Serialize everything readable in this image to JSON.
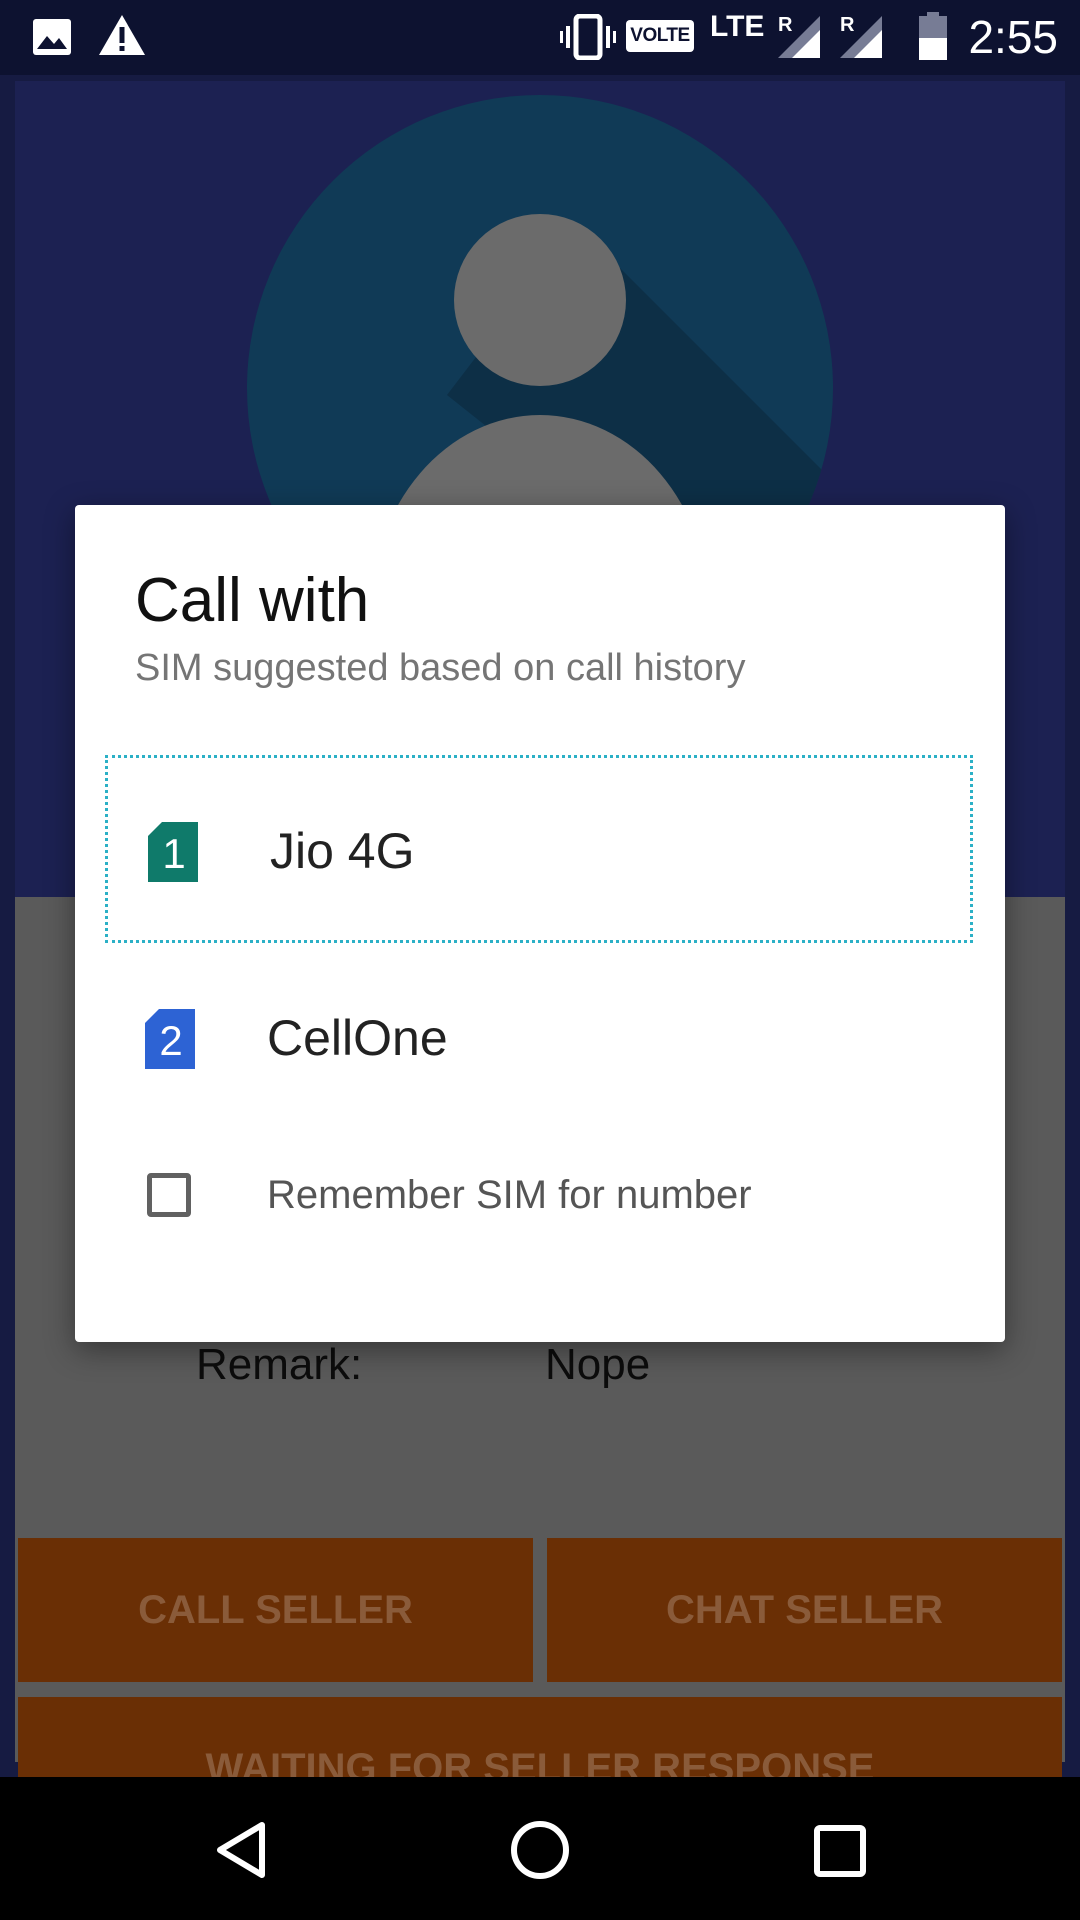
{
  "status_bar": {
    "time": "2:55",
    "volte": "VOLTE",
    "network": "LTE",
    "roaming_1": "R",
    "roaming_2": "R",
    "icons": [
      "image-icon",
      "warning-icon",
      "vibrate-icon",
      "signal-icon",
      "signal-icon",
      "battery-icon"
    ]
  },
  "details": {
    "remark_label": "Remark:",
    "remark_value": "Nope"
  },
  "actions": {
    "call_seller": "CALL SELLER",
    "chat_seller": "CHAT SELLER",
    "waiting": "WAITING FOR SELLER RESPONSE"
  },
  "dialog": {
    "title": "Call with",
    "subtitle": "SIM suggested based on call history",
    "sims": [
      {
        "slot": "1",
        "label": "Jio 4G",
        "color": "#0f7a6a"
      },
      {
        "slot": "2",
        "label": "CellOne",
        "color": "#2d63d4"
      }
    ],
    "remember_label": "Remember SIM for number",
    "remember_checked": false
  },
  "colors": {
    "status_bar": "#0d1230",
    "header": "#1c2152",
    "button": "#6a2f05",
    "focus_outline": "#2bb0c6"
  },
  "nav": {
    "icons": [
      "back-icon",
      "home-icon",
      "recents-icon"
    ]
  }
}
